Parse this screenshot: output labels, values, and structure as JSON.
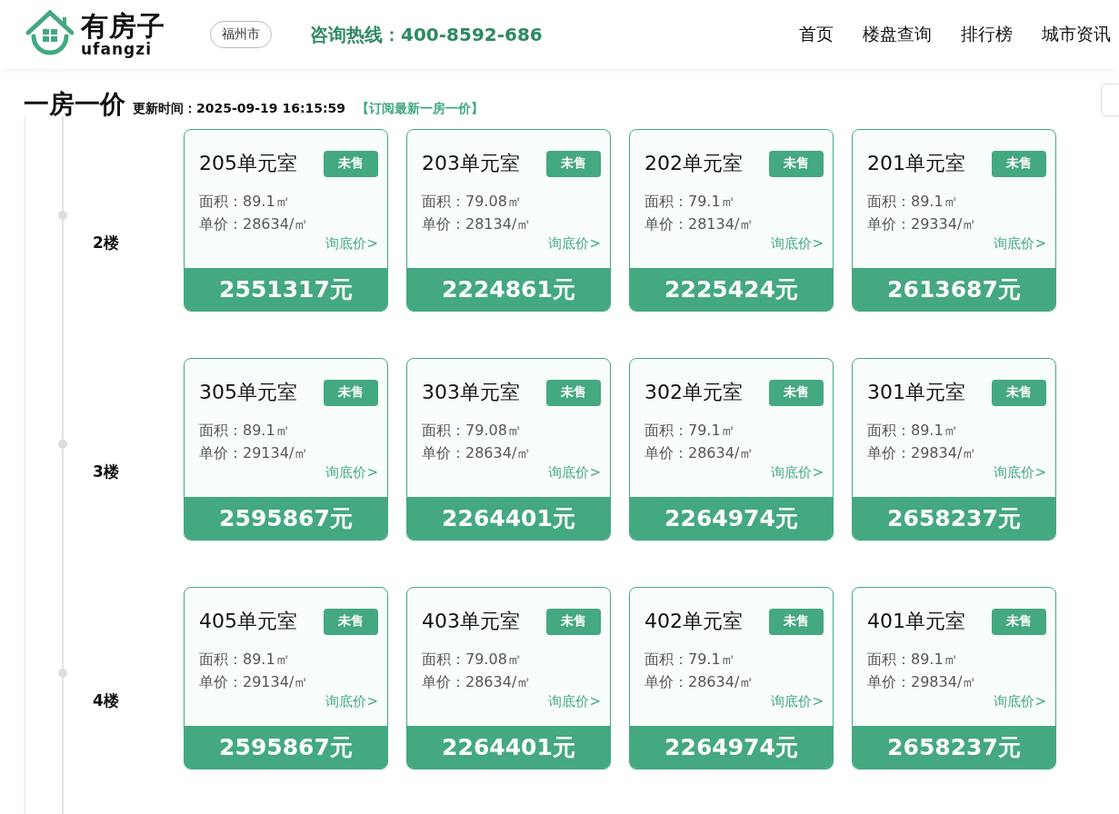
{
  "header": {
    "logo": {
      "name": "有房子",
      "subtitle": "ufangzi"
    },
    "city": "福州市",
    "hotline": "咨询热线：400-8592-686",
    "nav": [
      "首页",
      "楼盘查询",
      "排行榜",
      "城市资讯"
    ]
  },
  "page": {
    "title": "一房一价",
    "updated": "更新时间：2025-09-19 16:15:59",
    "subscribe": "【订阅最新一房一价】"
  },
  "floors": [
    {
      "label": "2楼",
      "units": [
        {
          "room": "205单元室",
          "status": "未售",
          "area": "面积：89.1㎡",
          "unit_price": "单价：28634/㎡",
          "inquiry": "询底价>",
          "price": "2551317元"
        },
        {
          "room": "203单元室",
          "status": "未售",
          "area": "面积：79.08㎡",
          "unit_price": "单价：28134/㎡",
          "inquiry": "询底价>",
          "price": "2224861元"
        },
        {
          "room": "202单元室",
          "status": "未售",
          "area": "面积：79.1㎡",
          "unit_price": "单价：28134/㎡",
          "inquiry": "询底价>",
          "price": "2225424元"
        },
        {
          "room": "201单元室",
          "status": "未售",
          "area": "面积：89.1㎡",
          "unit_price": "单价：29334/㎡",
          "inquiry": "询底价>",
          "price": "2613687元"
        }
      ]
    },
    {
      "label": "3楼",
      "units": [
        {
          "room": "305单元室",
          "status": "未售",
          "area": "面积：89.1㎡",
          "unit_price": "单价：29134/㎡",
          "inquiry": "询底价>",
          "price": "2595867元"
        },
        {
          "room": "303单元室",
          "status": "未售",
          "area": "面积：79.08㎡",
          "unit_price": "单价：28634/㎡",
          "inquiry": "询底价>",
          "price": "2264401元"
        },
        {
          "room": "302单元室",
          "status": "未售",
          "area": "面积：79.1㎡",
          "unit_price": "单价：28634/㎡",
          "inquiry": "询底价>",
          "price": "2264974元"
        },
        {
          "room": "301单元室",
          "status": "未售",
          "area": "面积：89.1㎡",
          "unit_price": "单价：29834/㎡",
          "inquiry": "询底价>",
          "price": "2658237元"
        }
      ]
    },
    {
      "label": "4楼",
      "units": [
        {
          "room": "405单元室",
          "status": "未售",
          "area": "面积：89.1㎡",
          "unit_price": "单价：29134/㎡",
          "inquiry": "询底价>",
          "price": "2595867元"
        },
        {
          "room": "403单元室",
          "status": "未售",
          "area": "面积：79.08㎡",
          "unit_price": "单价：28634/㎡",
          "inquiry": "询底价>",
          "price": "2264401元"
        },
        {
          "room": "402单元室",
          "status": "未售",
          "area": "面积：79.1㎡",
          "unit_price": "单价：28634/㎡",
          "inquiry": "询底价>",
          "price": "2264974元"
        },
        {
          "room": "401单元室",
          "status": "未售",
          "area": "面积：89.1㎡",
          "unit_price": "单价：29834/㎡",
          "inquiry": "询底价>",
          "price": "2658237元"
        }
      ]
    }
  ]
}
